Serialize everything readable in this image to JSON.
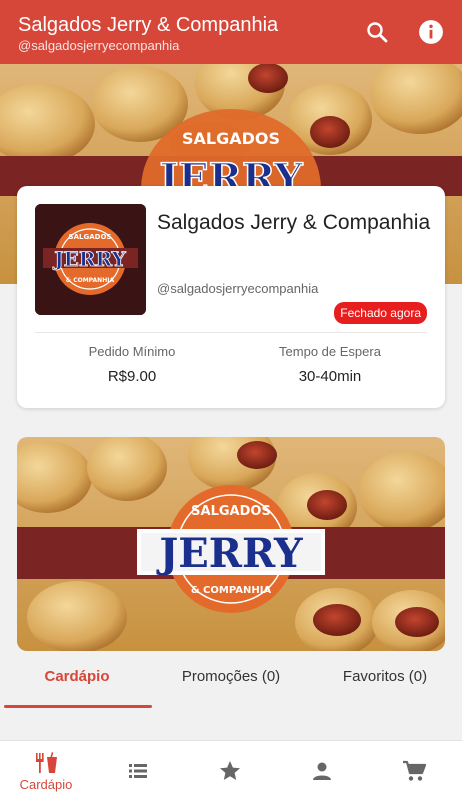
{
  "header": {
    "title": "Salgados Jerry & Companhia",
    "subtitle": "@salgadosjerryecompanhia"
  },
  "logo": {
    "top_text": "SALGADOS",
    "main_text": "JERRY",
    "bottom_text": "& COMPANHIA"
  },
  "store": {
    "name": "Salgados Jerry & Companhia",
    "handle": "@salgadosjerryecompanhia",
    "status": "Fechado agora",
    "min_order_label": "Pedido Mínimo",
    "min_order_value": "R$9.00",
    "wait_label": "Tempo de Espera",
    "wait_value": "30-40min"
  },
  "tabs": [
    {
      "label": "Cardápio",
      "active": true
    },
    {
      "label": "Promoções (0)",
      "active": false
    },
    {
      "label": "Favoritos (0)",
      "active": false
    }
  ],
  "bottom_nav": [
    {
      "icon": "cutlery-icon",
      "label": "Cardápio",
      "active": true
    },
    {
      "icon": "list-icon",
      "label": "",
      "active": false
    },
    {
      "icon": "star-icon",
      "label": "",
      "active": false
    },
    {
      "icon": "person-icon",
      "label": "",
      "active": false
    },
    {
      "icon": "cart-icon",
      "label": "",
      "active": false
    }
  ],
  "colors": {
    "primary": "#d6473a",
    "status_red": "#e81e1e",
    "band": "#7a2424",
    "icon_gray": "#666666"
  }
}
